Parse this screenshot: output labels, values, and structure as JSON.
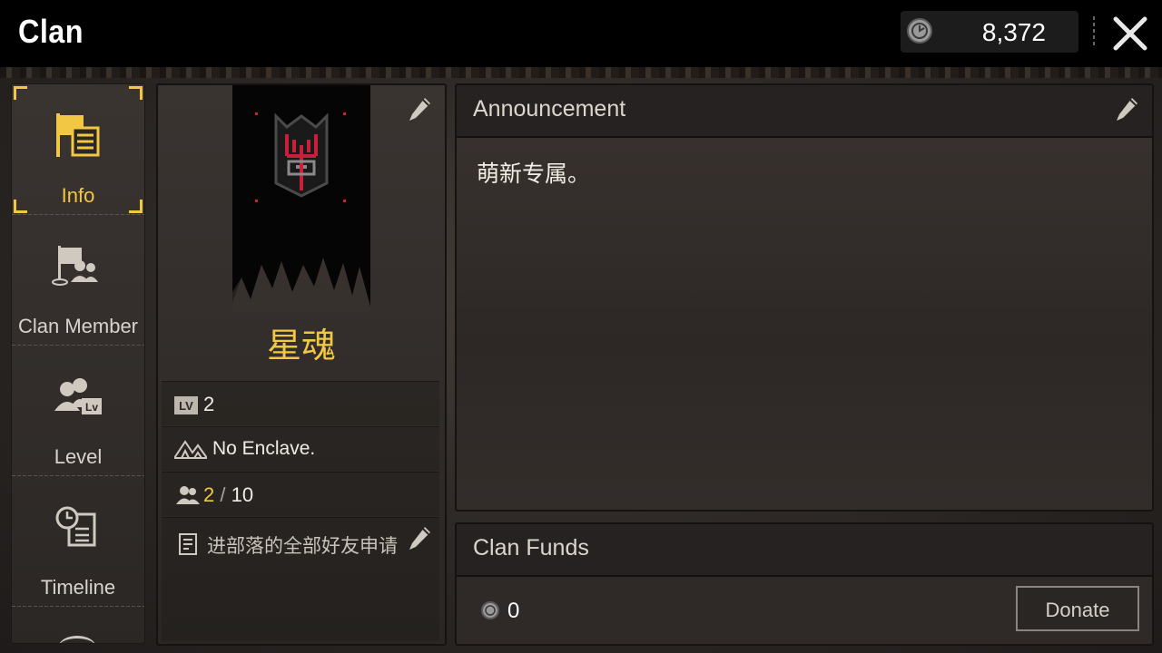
{
  "header": {
    "title": "Clan",
    "currency_amount": "8,372"
  },
  "nav": {
    "items": [
      {
        "label": "Info",
        "icon": "flag-document-icon",
        "active": true
      },
      {
        "label": "Clan Member",
        "icon": "flag-members-icon"
      },
      {
        "label": "Level",
        "icon": "members-level-icon"
      },
      {
        "label": "Timeline",
        "icon": "clock-document-icon"
      }
    ]
  },
  "clan": {
    "name": "星魂",
    "level": "2",
    "enclave": "No Enclave.",
    "members_current": "2",
    "members_sep": "/",
    "members_max": "10",
    "description": "进部落的全部好友申请"
  },
  "announcement": {
    "heading": "Announcement",
    "text": "萌新专属。"
  },
  "funds": {
    "heading": "Clan Funds",
    "amount": "0",
    "donate_label": "Donate"
  },
  "colors": {
    "accent": "#f2c744",
    "banner_red": "#c8203a"
  }
}
